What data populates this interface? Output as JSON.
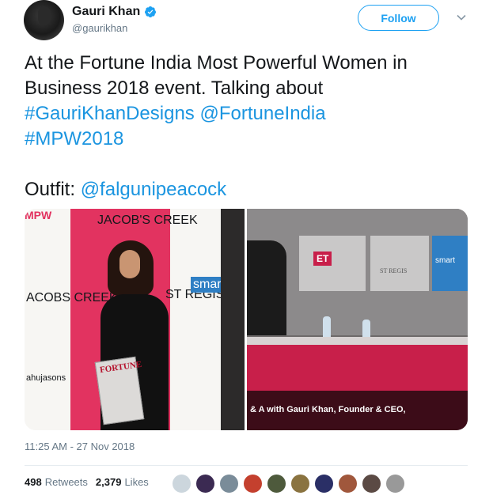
{
  "user": {
    "name": "Gauri Khan",
    "handle": "@gaurikhan",
    "follow_label": "Follow"
  },
  "tweet": {
    "text_1": "At the Fortune India Most Powerful Women in Business 2018 event. Talking about ",
    "hashtag_1": "#GauriKhanDesigns",
    "mention_1": "@FortuneIndia",
    "hashtag_2": "#MPW2018",
    "outfit_label": "Outfit: ",
    "mention_2": "@falgunipeacock"
  },
  "media": {
    "left_logos": {
      "mpw": "MPW",
      "jacobs_creek": "JACOB'S CREEK",
      "jacobs_creek_side": "ACOBS CREEK",
      "st_regis": "ST REGIS",
      "ahujasons": "ahujasons",
      "fortune": "FORTUNE",
      "smart_tag": "smart"
    },
    "right_caption": "& A with Gauri Khan, Founder & CEO,",
    "right_logos": {
      "et": "ET",
      "st_regis": "ST REGIS",
      "smart": "smart"
    }
  },
  "meta": {
    "timestamp": "11:25 AM - 27 Nov 2018",
    "retweets_count": "498",
    "retweets_label": "Retweets",
    "likes_count": "2,379",
    "likes_label": "Likes"
  },
  "colors": {
    "accent": "#1da1f2",
    "link": "#1b95e0",
    "text": "#14171a",
    "muted": "#657786"
  },
  "likers": [
    "avatar-1",
    "avatar-2",
    "avatar-3",
    "avatar-4",
    "avatar-5",
    "avatar-6",
    "avatar-7",
    "avatar-8",
    "avatar-9",
    "avatar-10"
  ]
}
